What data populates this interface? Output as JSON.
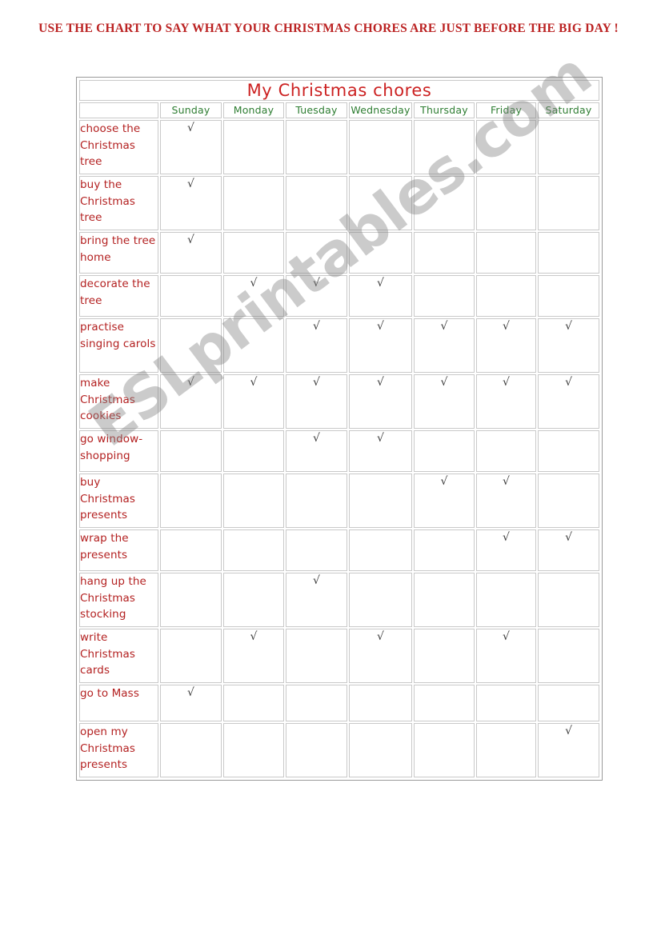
{
  "instruction": "USE THE CHART TO SAY WHAT YOUR CHRISTMAS CHORES ARE JUST BEFORE THE BIG DAY !",
  "watermark": "ESLprintables.com",
  "colors": {
    "headline_red": "#bb2222",
    "title_red": "#cc2222",
    "chore_red": "#b32020",
    "day_green": "#2e7d32",
    "grid_gray": "#c9c9c9",
    "check_gray": "#3a3a3a"
  },
  "check_glyph": "√",
  "chart_data": {
    "type": "table",
    "title": "My Christmas chores",
    "corner_label": "",
    "categories": [
      "Sunday",
      "Monday",
      "Tuesday",
      "Wednesday",
      "Thursday",
      "Friday",
      "Saturday"
    ],
    "rows": [
      {
        "label": "choose the Christmas tree",
        "lines": 3,
        "checks": [
          true,
          false,
          false,
          false,
          false,
          false,
          false
        ]
      },
      {
        "label": "buy the Christmas tree",
        "lines": 3,
        "checks": [
          true,
          false,
          false,
          false,
          false,
          false,
          false
        ]
      },
      {
        "label": "bring the tree home",
        "lines": 2,
        "checks": [
          true,
          false,
          false,
          false,
          false,
          false,
          false
        ]
      },
      {
        "label": "decorate the tree",
        "lines": 2,
        "checks": [
          false,
          true,
          true,
          true,
          false,
          false,
          false
        ]
      },
      {
        "label": "practise singing carols",
        "lines": 3,
        "checks": [
          false,
          false,
          true,
          true,
          true,
          true,
          true
        ]
      },
      {
        "label": "make Christmas cookies",
        "lines": 3,
        "checks": [
          true,
          true,
          true,
          true,
          true,
          true,
          true
        ]
      },
      {
        "label": "go window-shopping",
        "lines": 2,
        "checks": [
          false,
          false,
          true,
          true,
          false,
          false,
          false
        ]
      },
      {
        "label": "buy Christmas presents",
        "lines": 3,
        "checks": [
          false,
          false,
          false,
          false,
          true,
          true,
          false
        ]
      },
      {
        "label": "wrap the presents",
        "lines": 2,
        "checks": [
          false,
          false,
          false,
          false,
          false,
          true,
          true
        ]
      },
      {
        "label": "hang up the Christmas stocking",
        "lines": 3,
        "checks": [
          false,
          false,
          true,
          false,
          false,
          false,
          false
        ]
      },
      {
        "label": "write Christmas cards",
        "lines": 3,
        "checks": [
          false,
          true,
          false,
          true,
          false,
          true,
          false
        ]
      },
      {
        "label": "go to Mass",
        "lines": 1,
        "checks": [
          true,
          false,
          false,
          false,
          false,
          false,
          false
        ]
      },
      {
        "label": "open my Christmas presents",
        "lines": 3,
        "checks": [
          false,
          false,
          false,
          false,
          false,
          false,
          true
        ]
      }
    ],
    "xlabel": "",
    "ylabel": "",
    "grid": true,
    "legend": "none"
  }
}
